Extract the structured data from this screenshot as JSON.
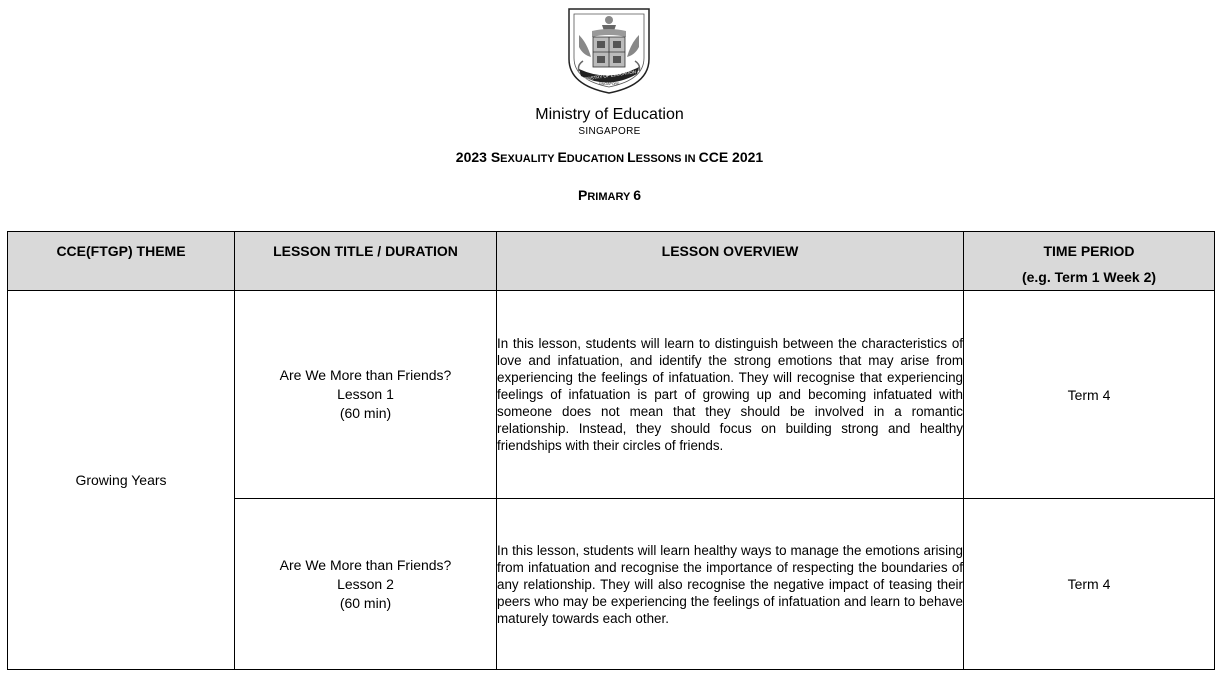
{
  "header": {
    "crest_text": "MINISTRY OF EDUCATION",
    "crest_subtext": "SINGAPORE",
    "ministry": "Ministry of Education",
    "country": "SINGAPORE",
    "title_parts": [
      "2023 S",
      "EXUALITY ",
      "E",
      "DUCATION ",
      "L",
      "ESSONS IN ",
      "CCE 2021"
    ],
    "subtitle_parts": [
      "P",
      "RIMARY ",
      "6"
    ]
  },
  "table": {
    "headers": {
      "theme": "CCE(FTGP) THEME",
      "lesson_title": "LESSON TITLE / DURATION",
      "overview": "LESSON OVERVIEW",
      "time_period_line1": "TIME PERIOD",
      "time_period_line2": "(e.g. Term 1 Week 2)"
    },
    "theme": "Growing Years",
    "rows": [
      {
        "title": "Are We More than Friends?",
        "lesson": "Lesson 1",
        "duration": "(60 min)",
        "overview": "In this lesson, students will learn to distinguish between the characteristics of love and infatuation, and identify the strong emotions that may arise from experiencing the feelings of infatuation. They will recognise that experiencing feelings of infatuation is part of growing up and becoming infatuated with someone does not mean that they should be involved in a romantic relationship. Instead, they should focus on building strong and healthy friendships with their circles of friends.",
        "time_period": "Term 4"
      },
      {
        "title": "Are We More than Friends?",
        "lesson": "Lesson 2",
        "duration": "(60 min)",
        "overview": "In this lesson, students will learn healthy ways to manage the emotions arising from infatuation and recognise the importance of respecting the boundaries of any relationship. They will also recognise the negative impact of teasing their peers who may be experiencing the feelings of infatuation and learn to behave maturely towards each other.",
        "time_period": "Term 4"
      }
    ]
  }
}
